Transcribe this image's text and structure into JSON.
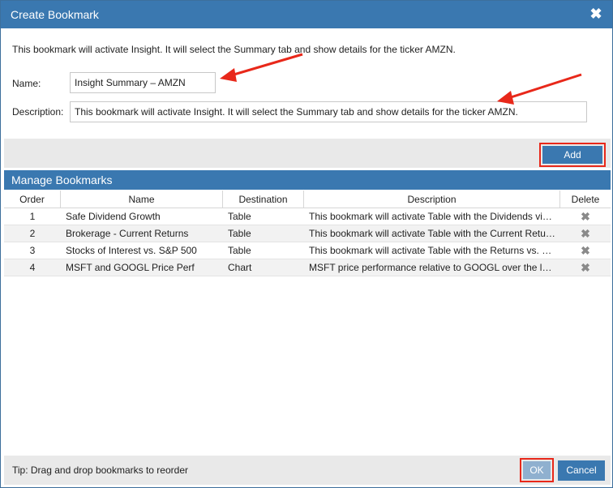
{
  "window": {
    "title": "Create Bookmark",
    "close_glyph": "✖"
  },
  "intro_text": "This bookmark will activate Insight. It will select the Summary tab and show details for the ticker AMZN.",
  "form": {
    "name_label": "Name:",
    "name_value": "Insight Summary – AMZN",
    "description_label": "Description:",
    "description_value": "This bookmark will activate Insight. It will select the Summary tab and show details for the ticker AMZN.",
    "add_label": "Add"
  },
  "manage": {
    "title": "Manage Bookmarks",
    "columns": [
      "Order",
      "Name",
      "Destination",
      "Description",
      "Delete"
    ],
    "rows": [
      {
        "order": "1",
        "name": "Safe Dividend Growth",
        "destination": "Table",
        "description": "This bookmark will activate Table with the Dividends vi…"
      },
      {
        "order": "2",
        "name": "Brokerage - Current Returns",
        "destination": "Table",
        "description": "This bookmark will activate Table with the Current Retu…"
      },
      {
        "order": "3",
        "name": "Stocks of Interest vs. S&P 500",
        "destination": "Table",
        "description": "This bookmark will activate Table with the Returns vs. …"
      },
      {
        "order": "4",
        "name": "MSFT and GOOGL Price Perf",
        "destination": "Chart",
        "description": "MSFT price performance relative to GOOGL over the l…"
      }
    ],
    "delete_glyph": "✖"
  },
  "footer": {
    "tip": "Tip: Drag and drop bookmarks to reorder",
    "ok_label": "OK",
    "cancel_label": "Cancel"
  },
  "colors": {
    "accent": "#3a78b0",
    "highlight": "#e8281a",
    "bar_gray": "#e9e9e9"
  }
}
